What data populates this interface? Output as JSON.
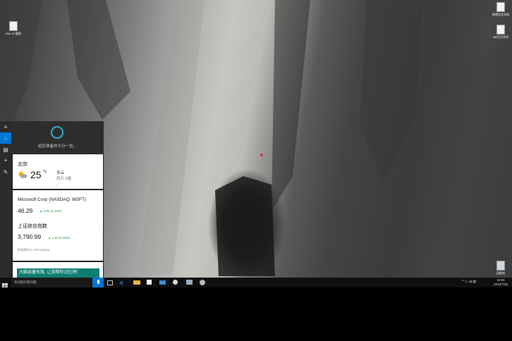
{
  "desktop": {
    "icons": [
      {
        "label": "Win 10 截图",
        "icon": "document-icon"
      },
      {
        "label": "新建文本文档",
        "icon": "document-icon"
      },
      {
        "label": "360打开文件",
        "icon": "document-icon"
      },
      {
        "label": "回收站",
        "icon": "recycle-bin-icon"
      }
    ]
  },
  "cortana": {
    "greeting": "给您准备的今日一览。",
    "weather": {
      "city": "北京",
      "temp": "25",
      "unit": "℃",
      "condition": "多云",
      "wind": "风力 2级",
      "icon": "partly-cloudy-icon"
    },
    "stocks": [
      {
        "name": "Microsoft Corp (NASDAQ: MSFT)",
        "price": "46.29",
        "change": "▲ 0.95 (2.10%)"
      },
      {
        "name": "上证综合指数",
        "price": "3,790.99",
        "change": "▲ 1.91 (0.05%)"
      }
    ],
    "data_source": "数据提供方: Morningstar",
    "promo": "大脑容量有限, 让我帮你记忆吧!"
  },
  "taskbar": {
    "search_placeholder": "有问题尽管问我",
    "clock_time": "10:06",
    "clock_date": "2015/7/30",
    "accent": "#0078d7"
  }
}
